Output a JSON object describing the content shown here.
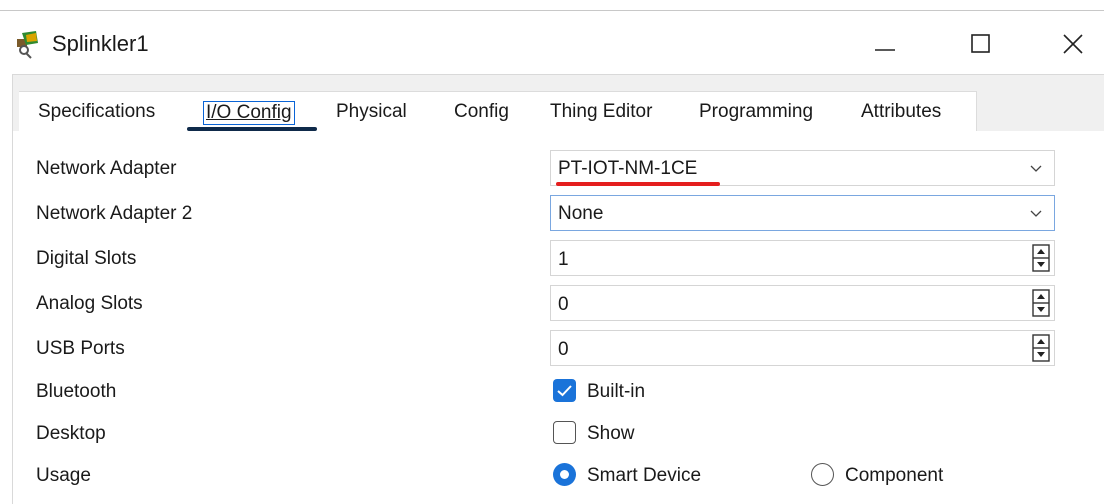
{
  "window": {
    "title": "Splinkler1",
    "minimize_label": "Minimize",
    "maximize_label": "Maximize",
    "close_label": "Close"
  },
  "tabs": [
    {
      "label": "Specifications",
      "active": false
    },
    {
      "label": "I/O Config",
      "active": true
    },
    {
      "label": "Physical",
      "active": false
    },
    {
      "label": "Config",
      "active": false
    },
    {
      "label": "Thing Editor",
      "active": false
    },
    {
      "label": "Programming",
      "active": false
    },
    {
      "label": "Attributes",
      "active": false
    }
  ],
  "form": {
    "network_adapter": {
      "label": "Network Adapter",
      "value": "PT-IOT-NM-1CE"
    },
    "network_adapter_2": {
      "label": "Network Adapter 2",
      "value": "None"
    },
    "digital_slots": {
      "label": "Digital Slots",
      "value": "1"
    },
    "analog_slots": {
      "label": "Analog Slots",
      "value": "0"
    },
    "usb_ports": {
      "label": "USB Ports",
      "value": "0"
    },
    "bluetooth": {
      "label": "Bluetooth",
      "option_label": "Built-in",
      "checked": true
    },
    "desktop": {
      "label": "Desktop",
      "option_label": "Show",
      "checked": false
    },
    "usage": {
      "label": "Usage",
      "options": [
        {
          "label": "Smart Device",
          "selected": true
        },
        {
          "label": "Component",
          "selected": false
        }
      ]
    }
  },
  "colors": {
    "accent": "#1a73d9",
    "active_tab_underline": "#0f2a4a",
    "annotation_red": "#e41e1e"
  }
}
